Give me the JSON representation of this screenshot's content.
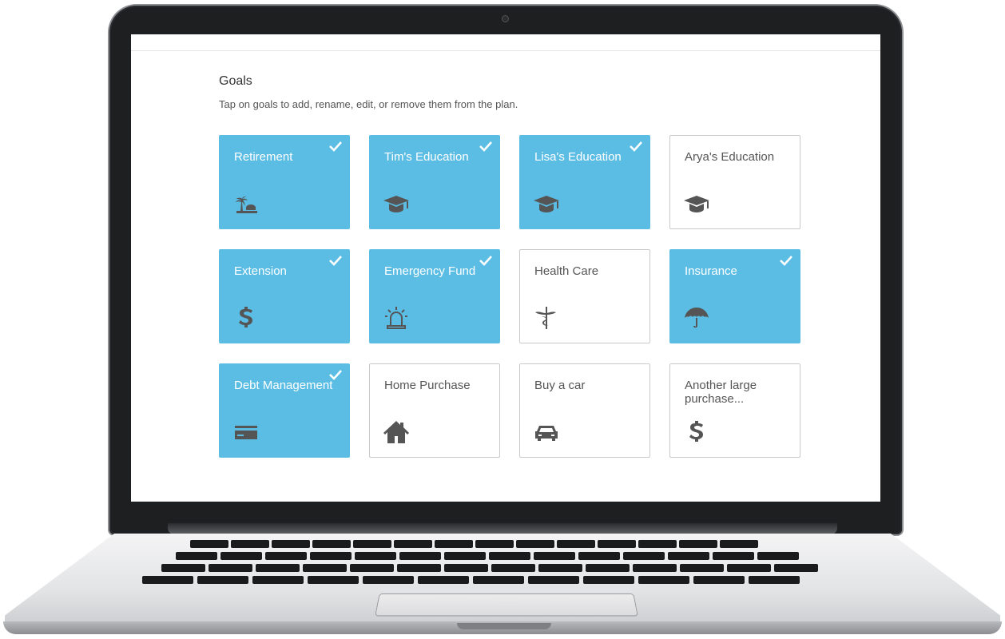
{
  "page": {
    "title": "Goals",
    "subtitle": "Tap on goals to add, rename, edit, or remove them from the plan."
  },
  "colors": {
    "selected": "#5bbde4",
    "icon_gray": "#555555"
  },
  "goals": [
    {
      "label": "Retirement",
      "selected": true,
      "icon": "island-icon"
    },
    {
      "label": "Tim's Education",
      "selected": true,
      "icon": "graduation-cap-icon"
    },
    {
      "label": "Lisa's Education",
      "selected": true,
      "icon": "graduation-cap-icon"
    },
    {
      "label": "Arya's Education",
      "selected": false,
      "icon": "graduation-cap-icon"
    },
    {
      "label": "Extension",
      "selected": true,
      "icon": "dollar-icon"
    },
    {
      "label": "Emergency Fund",
      "selected": true,
      "icon": "alarm-light-icon"
    },
    {
      "label": "Health Care",
      "selected": false,
      "icon": "caduceus-icon"
    },
    {
      "label": "Insurance",
      "selected": true,
      "icon": "umbrella-icon"
    },
    {
      "label": "Debt Management",
      "selected": true,
      "icon": "credit-card-icon"
    },
    {
      "label": "Home Purchase",
      "selected": false,
      "icon": "house-icon"
    },
    {
      "label": "Buy a car",
      "selected": false,
      "icon": "car-icon"
    },
    {
      "label": "Another large purchase...",
      "selected": false,
      "icon": "dollar-icon"
    }
  ]
}
